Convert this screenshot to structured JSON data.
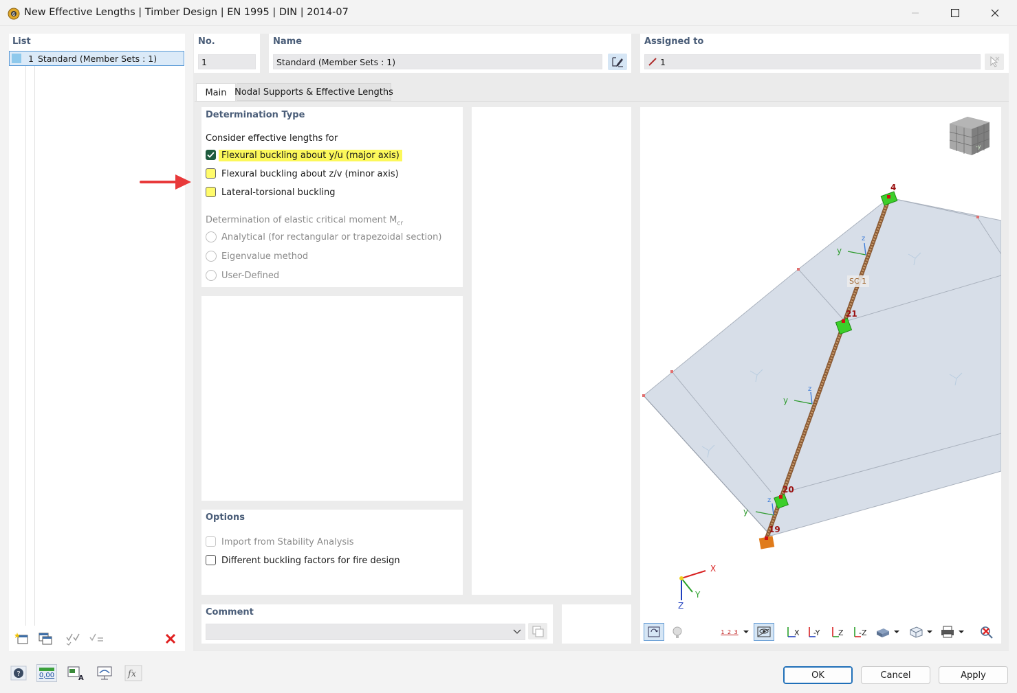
{
  "window": {
    "title": "New Effective Lengths | Timber Design | EN 1995 | DIN | 2014-07"
  },
  "list": {
    "header": "List",
    "items": [
      {
        "number": "1",
        "label": "Standard (Member Sets : 1)"
      }
    ]
  },
  "number": {
    "label": "No.",
    "value": "1"
  },
  "name": {
    "label": "Name",
    "value": "Standard (Member Sets : 1)"
  },
  "assigned": {
    "label": "Assigned to",
    "value": "1"
  },
  "tabs": [
    "Main",
    "Nodal Supports & Effective Lengths"
  ],
  "determination": {
    "header": "Determination Type",
    "consider_label": "Consider effective lengths for",
    "options": [
      {
        "label": "Flexural buckling about y/u (major axis)",
        "checked": true
      },
      {
        "label": "Flexural buckling about z/v (minor axis)",
        "checked": false
      },
      {
        "label": "Lateral-torsional buckling",
        "checked": false
      }
    ],
    "mcr_label": "Determination of elastic critical moment M",
    "mcr_sub": "cr",
    "mcr_options": [
      "Analytical (for rectangular or trapezoidal section)",
      "Eigenvalue method",
      "User-Defined"
    ]
  },
  "options": {
    "header": "Options",
    "items": [
      {
        "label": "Import from Stability Analysis",
        "checked": false,
        "enabled": false
      },
      {
        "label": "Different buckling factors for fire design",
        "checked": false,
        "enabled": true
      }
    ]
  },
  "comment": {
    "label": "Comment",
    "value": ""
  },
  "viewport": {
    "nodes": [
      "4",
      "21",
      "20",
      "19"
    ],
    "member_label": "SC 1",
    "local_axes": {
      "y": "y",
      "z": "z"
    },
    "global_axes": {
      "x": "X",
      "y": "Y",
      "z": "Z"
    },
    "cube_face": "-y"
  },
  "buttons": {
    "ok": "OK",
    "cancel": "Cancel",
    "apply": "Apply"
  },
  "footer_icons": {
    "units_label": "0,00"
  },
  "toolbar_labels": {
    "numbering": "1 2 3"
  },
  "colors": {
    "accent_header": "#4a5d78",
    "highlight": "#fcf85a",
    "check": "#1e5b3e",
    "surface": "#d7dee8",
    "member": "#a8774f",
    "node": "#b01010",
    "support": "#3ccf2a",
    "arrow": "#e8393a",
    "close_red": "#e02020"
  }
}
